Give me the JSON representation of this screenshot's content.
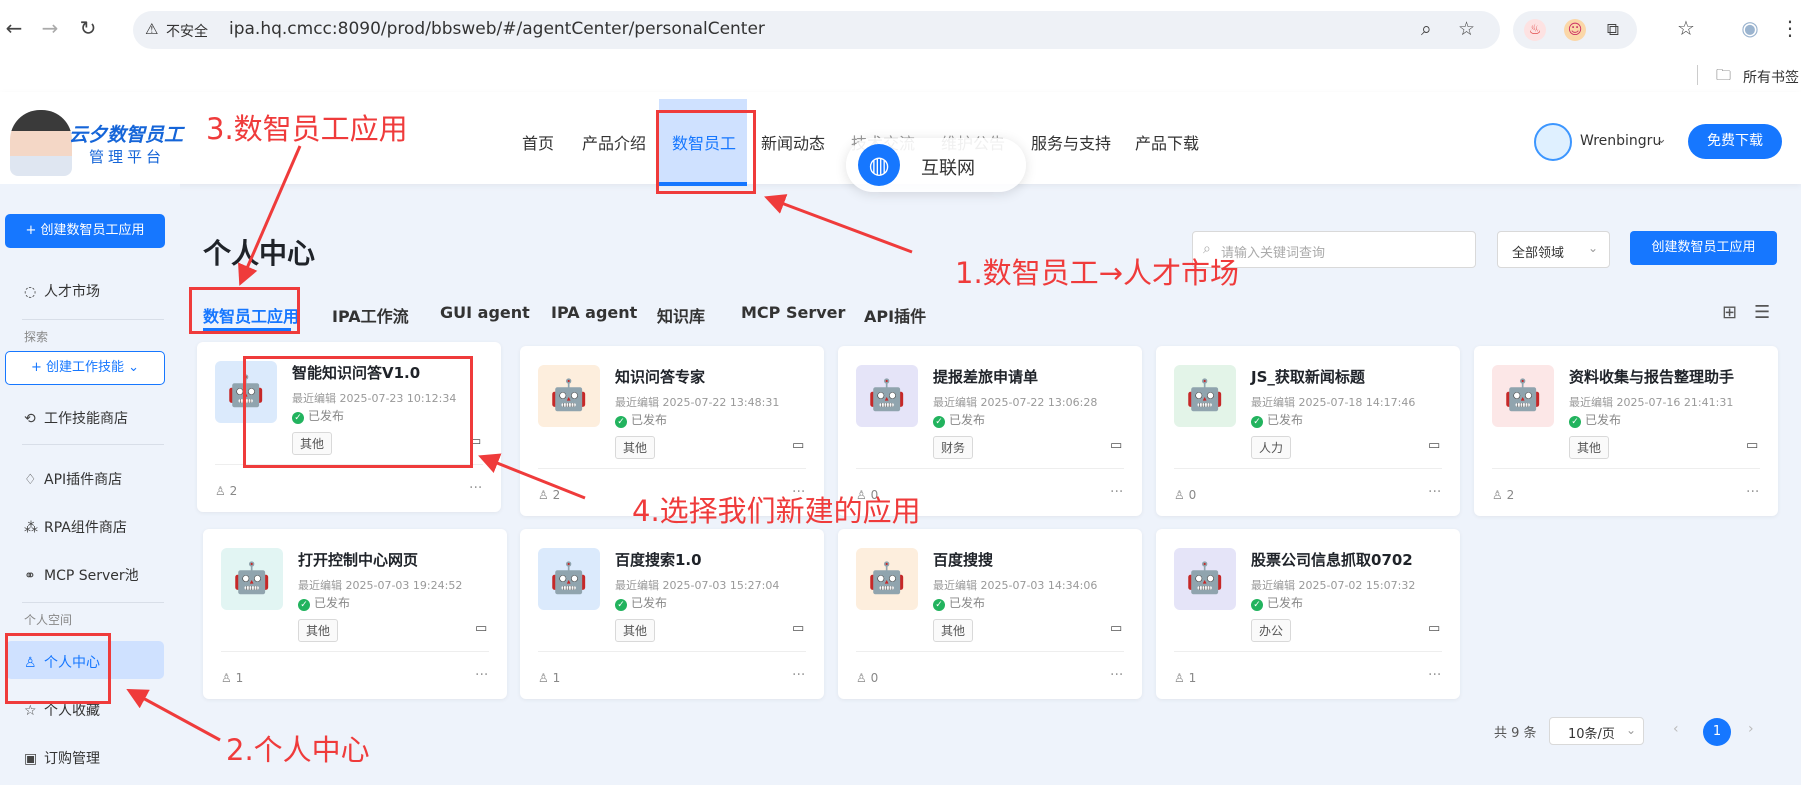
{
  "browser": {
    "insecure_label": "不安全",
    "url": "ipa.hq.cmcc:8090/prod/bbsweb/#/agentCenter/personalCenter",
    "bookmarks_label": "所有书签"
  },
  "header": {
    "logo_title": "云夕数智员工",
    "logo_subtitle": "管理平台",
    "nav": [
      "首页",
      "产品介绍",
      "数智员工",
      "新闻动态",
      "技术交流",
      "维护公告",
      "服务与支持",
      "产品下载"
    ],
    "active_nav": "数智员工",
    "overlay_label": "互联网",
    "username": "Wrenbingru",
    "download_label": "免费下载"
  },
  "sidebar": {
    "create_app_label": "+ 创建数智员工应用",
    "talent_market": "人才市场",
    "explore_label": "探索",
    "create_skill_label": "+ 创建工作技能",
    "skill_store": "工作技能商店",
    "api_store": "API插件商店",
    "rpa_store": "RPA组件商店",
    "mcp_pool": "MCP Server池",
    "personal_space_label": "个人空间",
    "personal_center": "个人中心",
    "favorites": "个人收藏",
    "subscriptions": "订购管理"
  },
  "main": {
    "title": "个人中心",
    "search_placeholder": "请输入关键词查询",
    "domain_filter": "全部领域",
    "create_button": "创建数智员工应用",
    "tabs": [
      "数智员工应用",
      "IPA工作流",
      "GUI agent",
      "IPA agent",
      "知识库",
      "MCP Server",
      "API插件"
    ],
    "active_tab": "数智员工应用",
    "published_label": "已发布"
  },
  "cards": [
    {
      "title": "智能知识问答V1.0",
      "meta": "最近编辑 2025-07-23 10:12:34",
      "tag": "其他",
      "users": "2",
      "bg": "#dbeafc"
    },
    {
      "title": "知识问答专家",
      "meta": "最近编辑 2025-07-22 13:48:31",
      "tag": "其他",
      "users": "2",
      "bg": "#fdeedd"
    },
    {
      "title": "提报差旅申请单",
      "meta": "最近编辑 2025-07-22 13:06:28",
      "tag": "财务",
      "users": "0",
      "bg": "#e5e4f8"
    },
    {
      "title": "JS_获取新闻标题",
      "meta": "最近编辑 2025-07-18 14:17:46",
      "tag": "人力",
      "users": "0",
      "bg": "#e3f4e8"
    },
    {
      "title": "资料收集与报告整理助手",
      "meta": "最近编辑 2025-07-16 21:41:31",
      "tag": "其他",
      "users": "2",
      "bg": "#fce7e7"
    },
    {
      "title": "打开控制中心网页",
      "meta": "最近编辑 2025-07-03 19:24:52",
      "tag": "其他",
      "users": "1",
      "bg": "#e2f5f3"
    },
    {
      "title": "百度搜索1.0",
      "meta": "最近编辑 2025-07-03 15:27:04",
      "tag": "其他",
      "users": "1",
      "bg": "#dbeafc"
    },
    {
      "title": "百度搜搜",
      "meta": "最近编辑 2025-07-03 14:34:06",
      "tag": "其他",
      "users": "0",
      "bg": "#fdeedd"
    },
    {
      "title": "股票公司信息抓取0702",
      "meta": "最近编辑 2025-07-02 15:07:32",
      "tag": "办公",
      "users": "1",
      "bg": "#e5e4f8"
    }
  ],
  "pagination": {
    "total": "共 9 条",
    "page_size": "10条/页",
    "current_page": "1"
  },
  "annotations": {
    "step1": "1.数智员工→人才市场",
    "step2": "2.个人中心",
    "step3": "3.数智员工应用",
    "step4": "4.选择我们新建的应用"
  },
  "colors": {
    "accent": "#1677ff",
    "annotation": "#ef3b3b",
    "published": "#22b35e"
  }
}
